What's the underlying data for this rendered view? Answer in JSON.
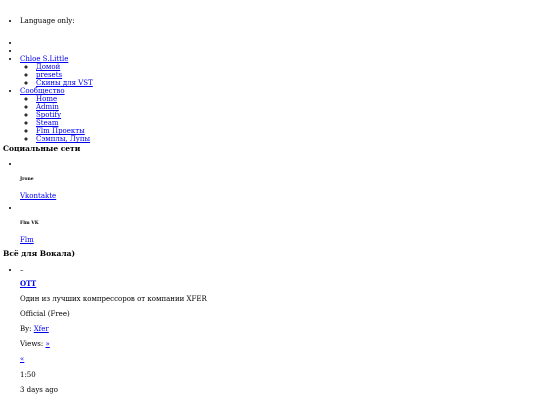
{
  "language_label": "Language only:",
  "nav": {
    "items": [
      {
        "label": ""
      },
      {
        "label": ""
      },
      {
        "label": "Chloe S.Little",
        "children": [
          "Домой",
          "presets",
          "Скины для VST"
        ]
      },
      {
        "label": "Сообщество",
        "children": [
          "Home",
          "Admin",
          "Spotify",
          "Steam",
          "Flm Проекты",
          "Сэмплы, Лупы"
        ]
      }
    ]
  },
  "social": {
    "title": "Социальные сети",
    "items": [
      {
        "caption": "Jrone",
        "link": "Vkontakte"
      },
      {
        "caption": "Flm VK",
        "link": "Flm"
      }
    ]
  },
  "vocal": {
    "title": "Всё для Вокала)",
    "marker": "–",
    "item_title": "OTT",
    "description": "Один из лучших компрессоров от компании XFER",
    "license": "Official (Free)",
    "by_label": "By:",
    "by_link": "Xfer",
    "views_label": "Views:",
    "views_link": "»",
    "more_link": "«",
    "duration": "1:50",
    "date": "3 days ago"
  }
}
